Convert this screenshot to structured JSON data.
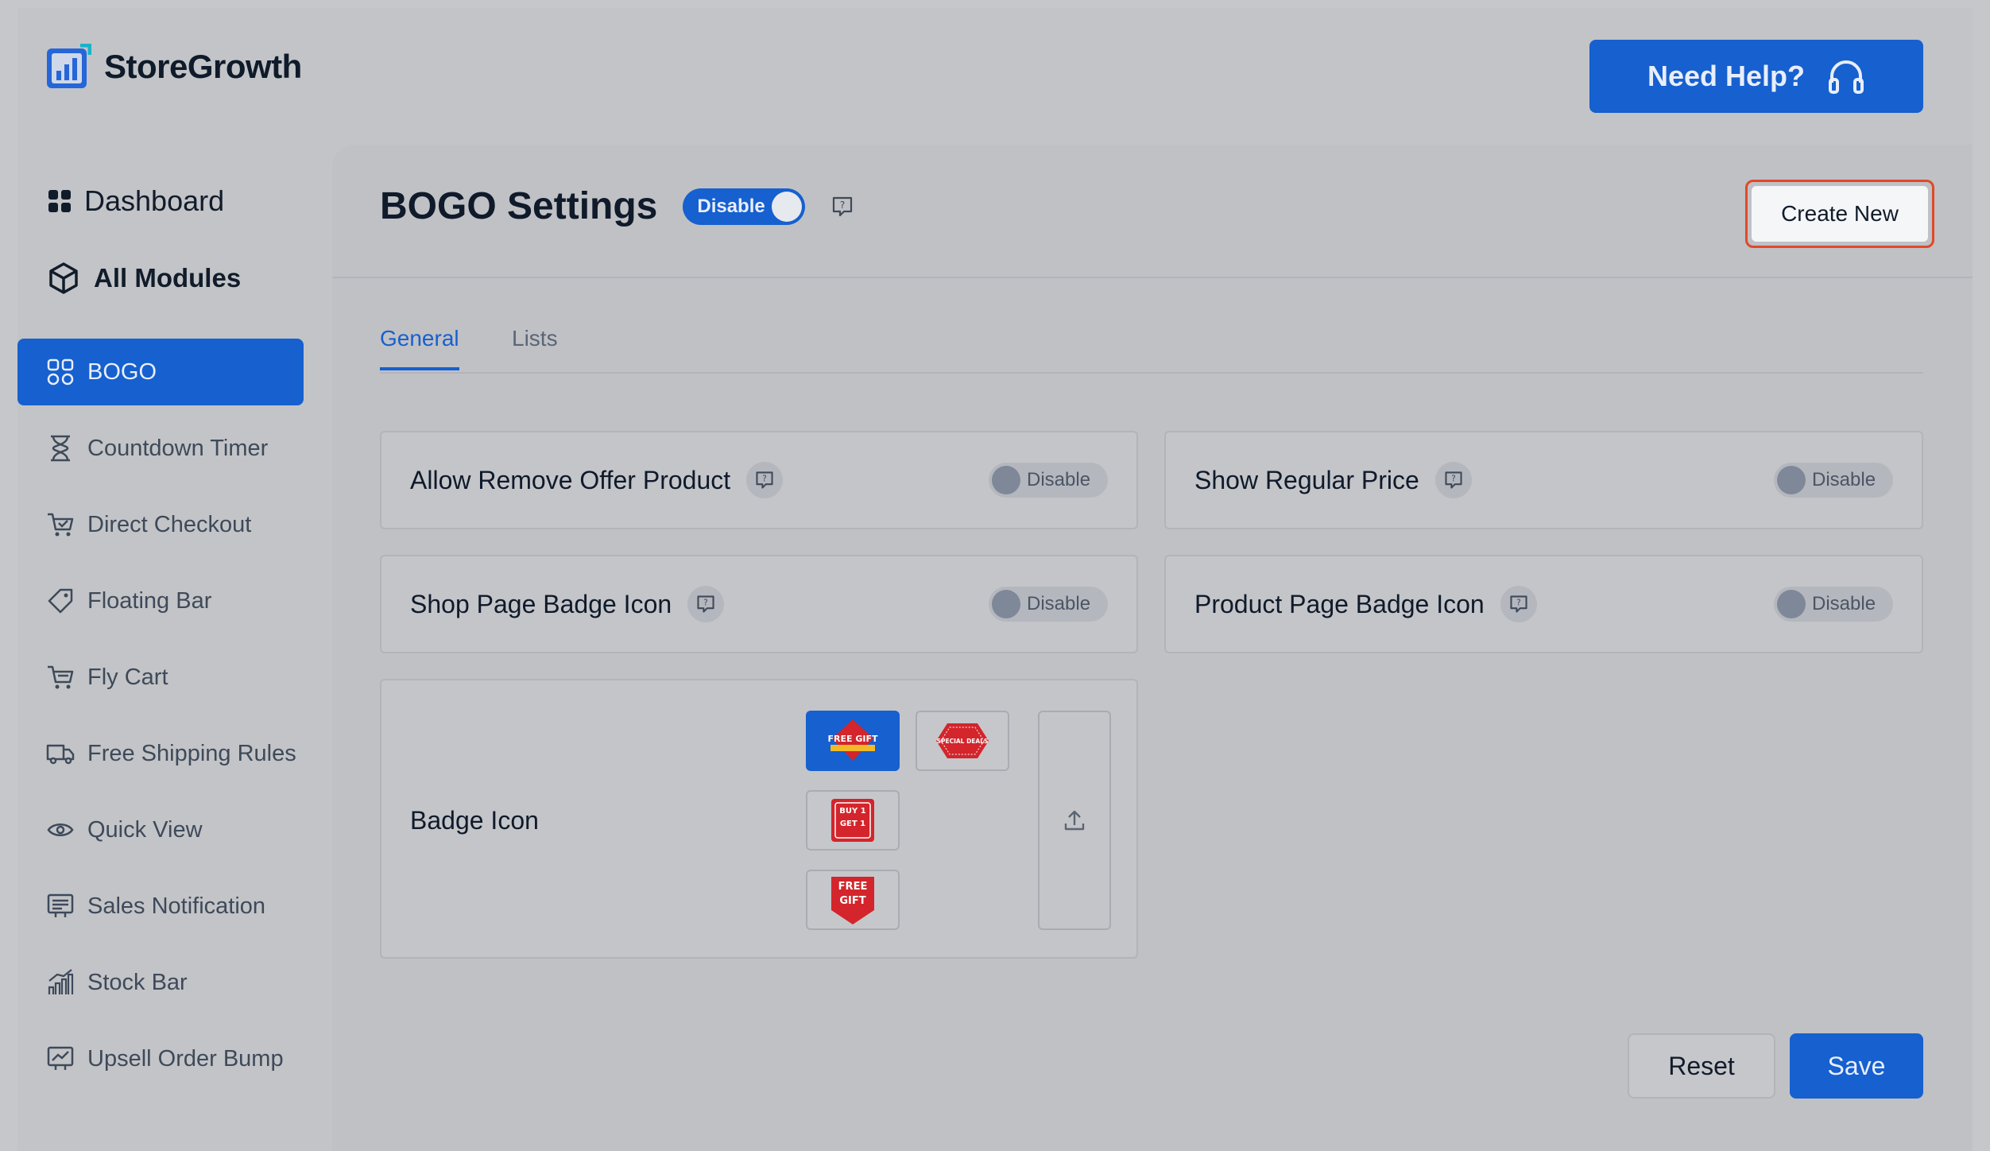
{
  "app": {
    "name": "StoreGrowth"
  },
  "header": {
    "help_label": "Need Help?"
  },
  "sidebar": {
    "dashboard": "Dashboard",
    "all_modules": "All Modules",
    "items": [
      {
        "label": "BOGO",
        "icon": "bogo-icon",
        "active": true
      },
      {
        "label": "Countdown Timer",
        "icon": "hourglass-icon"
      },
      {
        "label": "Direct Checkout",
        "icon": "cart-check-icon"
      },
      {
        "label": "Floating Bar",
        "icon": "tag-icon"
      },
      {
        "label": "Fly Cart",
        "icon": "cart-icon"
      },
      {
        "label": "Free Shipping Rules",
        "icon": "truck-icon"
      },
      {
        "label": "Quick View",
        "icon": "eye-icon"
      },
      {
        "label": "Sales Notification",
        "icon": "notification-icon"
      },
      {
        "label": "Stock Bar",
        "icon": "bar-chart-icon"
      },
      {
        "label": "Upsell Order Bump",
        "icon": "trend-chart-icon"
      }
    ]
  },
  "page": {
    "title": "BOGO Settings",
    "toggle_label": "Disable",
    "create_label": "Create New"
  },
  "tabs": [
    {
      "label": "General",
      "active": true
    },
    {
      "label": "Lists",
      "active": false
    }
  ],
  "settings": [
    {
      "label": "Allow Remove Offer Product",
      "state": "Disable"
    },
    {
      "label": "Show Regular Price",
      "state": "Disable"
    },
    {
      "label": "Shop Page Badge Icon",
      "state": "Disable"
    },
    {
      "label": "Product Page Badge Icon",
      "state": "Disable"
    }
  ],
  "badge": {
    "label": "Badge Icon",
    "options": [
      {
        "text": "FREE GIFT",
        "selected": true
      },
      {
        "text": "SPECIAL DEALS",
        "selected": false
      },
      {
        "text": "BUY 1 GET 1",
        "selected": false
      },
      {
        "text": "FREE GIFT",
        "selected": false
      }
    ]
  },
  "footer": {
    "reset_label": "Reset",
    "save_label": "Save"
  },
  "colors": {
    "accent": "#1660cf",
    "highlight": "#e0492a",
    "badge_red": "#d3252b"
  }
}
